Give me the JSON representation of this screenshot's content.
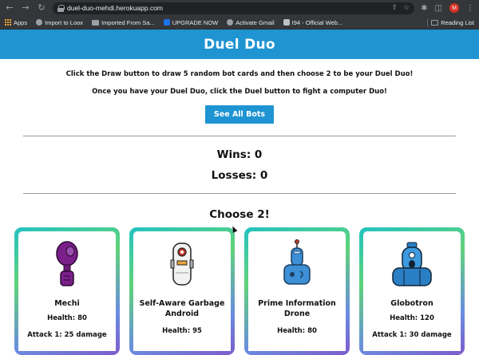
{
  "browser": {
    "url": "duel-duo-mehdi.herokuapp.com",
    "avatar_letter": "M",
    "bookmarks": [
      {
        "label": "Apps",
        "icon": "apps-grid-icon"
      },
      {
        "label": "Import to Loox",
        "icon": "globe-icon"
      },
      {
        "label": "Imported From Sa...",
        "icon": "folder-icon"
      },
      {
        "label": "UPGRADE NOW",
        "icon": "upgrade-icon"
      },
      {
        "label": "Activate Gmail",
        "icon": "globe-icon"
      },
      {
        "label": "I94 - Official Web...",
        "icon": "page-icon"
      }
    ],
    "reading_list": "Reading List"
  },
  "page": {
    "title": "Duel Duo",
    "instructions": [
      "Click the Draw button to draw 5 random bot cards and then choose 2 to be your Duel Duo!",
      "Once you have your Duel Duo, click the Duel button to fight a computer Duo!"
    ],
    "see_all_button": "See All Bots",
    "wins": "Wins: 0",
    "losses": "Losses: 0",
    "choose_heading": "Choose 2!"
  },
  "cards": [
    {
      "name": "Mechi",
      "health": "Health: 80",
      "attack": "Attack 1: 25 damage"
    },
    {
      "name": "Self-Aware Garbage Android",
      "health": "Health: 95",
      "attack": ""
    },
    {
      "name": "Prime Information Drone",
      "health": "Health: 80",
      "attack": ""
    },
    {
      "name": "Globotron",
      "health": "Health: 120",
      "attack": "Attack 1: 30 damage"
    }
  ],
  "colors": {
    "brand": "#1f94d2",
    "card_gradient": [
      "#23c2c0",
      "#5fd37a",
      "#6a8be0",
      "#7d5ccc"
    ]
  }
}
